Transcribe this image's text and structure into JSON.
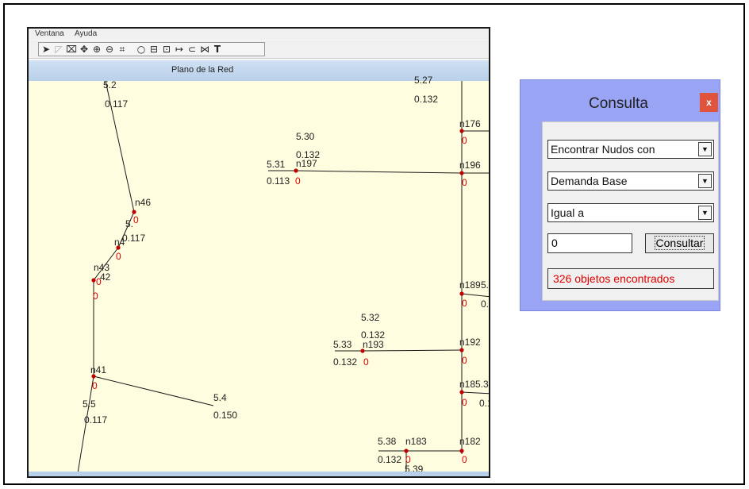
{
  "menu": {
    "item0": "Ventana",
    "item1": "Ayuda"
  },
  "toolbar": {
    "icons": [
      "select-arrow-icon",
      "select-vertex-icon",
      "select-region-icon",
      "pan-icon",
      "zoom-in-icon",
      "zoom-out-icon",
      "full-extent-icon",
      "add-junction-icon",
      "add-reservoir-icon",
      "add-tank-icon",
      "add-pipe-icon",
      "add-pump-icon",
      "add-valve-icon",
      "add-label-icon"
    ]
  },
  "map": {
    "title": "Plano de la Red",
    "link_labels": {
      "l52_id": "5.2",
      "l52_val": "0.117",
      "l527_id": "5.27",
      "l527_val": "0.132",
      "l530_id": "5.30",
      "l530_val": "0.132",
      "l531_id": "5.31",
      "l531_val": "0.113",
      "l532_id": "5.32",
      "l532_val": "0.132",
      "l533_id": "5.33",
      "l533_val": "0.132",
      "l54_id": "5.4",
      "l54_val": "0.150",
      "l55_id": "5.5",
      "l55_val": "0.117",
      "l538_id": "5.38",
      "l538_val": "0.132",
      "l539_id": "5.39",
      "l53x": "5.",
      "l53x_val": "0.117",
      "l42": "42"
    },
    "nodes": {
      "n176": "n176",
      "n197": "n197",
      "n196": "n196",
      "n46": "n46",
      "n4x": "n4",
      "n43": "n43",
      "n189": "n189",
      "n193": "n193",
      "n192": "n192",
      "n41": "n41",
      "n188": "n18",
      "n183": "n183",
      "n182": "n182",
      "r5_3a": "5.",
      "r5_3b": "5.3",
      "r0_a": "0.",
      "r0_b": "0.1"
    },
    "demand": "0"
  },
  "dialog": {
    "title": "Consulta",
    "close_label": "x",
    "find_select": "Encontrar Nudos con",
    "property_select": "Demanda Base",
    "relation_select": "Igual a",
    "value": "0",
    "submit_label": "Consultar",
    "result": "326 objetos encontrados"
  },
  "colors": {
    "canvas": "#fefde0",
    "node": "#c00000",
    "demand_text": "#e00000",
    "dialog_frame": "#9aa4f5",
    "close_button": "#e0533d"
  }
}
